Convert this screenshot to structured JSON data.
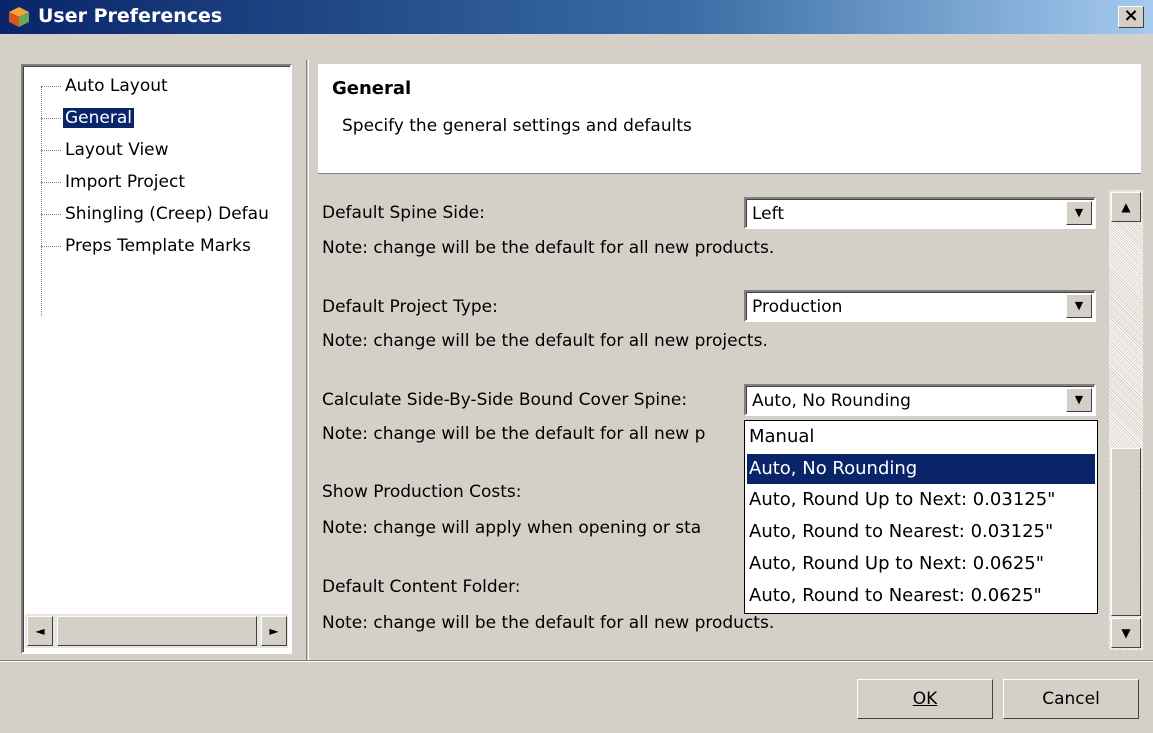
{
  "window": {
    "title": "User Preferences",
    "close_label": "×",
    "app_icon": "cube-icon"
  },
  "tree": {
    "items": [
      {
        "label": "Auto Layout"
      },
      {
        "label": "General"
      },
      {
        "label": "Layout View"
      },
      {
        "label": "Import Project"
      },
      {
        "label": "Shingling (Creep) Defau"
      },
      {
        "label": "Preps Template Marks"
      }
    ],
    "selected": "General",
    "scroll_left": "◄",
    "scroll_right": "►"
  },
  "header": {
    "title": "General",
    "description": "Specify the general settings and defaults"
  },
  "settings": {
    "spine_side": {
      "label": "Default Spine Side:",
      "value": "Left",
      "note": "Note: change will be the default for all new products."
    },
    "project_type": {
      "label": "Default Project Type:",
      "value": "Production",
      "note": "Note: change will be the default for all new projects."
    },
    "cover_spine": {
      "label": "Calculate Side-By-Side Bound Cover Spine:",
      "value": "Auto, No Rounding",
      "note": "Note: change will be the default for all new p"
    },
    "production_costs": {
      "label": "Show Production Costs:",
      "note": "Note: change will apply when opening or sta"
    },
    "content_folder": {
      "label": "Default Content Folder:",
      "note": "Note: change will be the default for all new products."
    }
  },
  "dropdown": {
    "options": [
      "Manual",
      "Auto, No Rounding",
      "Auto, Round Up to Next: 0.03125\"",
      "Auto, Round to Nearest: 0.03125\"",
      "Auto, Round Up to Next: 0.0625\"",
      "Auto, Round to Nearest: 0.0625\""
    ],
    "selected": "Auto, No Rounding"
  },
  "scroll": {
    "up": "▲",
    "down": "▼"
  },
  "combo_arrow": "▼",
  "buttons": {
    "ok": "OK",
    "cancel": "Cancel"
  }
}
